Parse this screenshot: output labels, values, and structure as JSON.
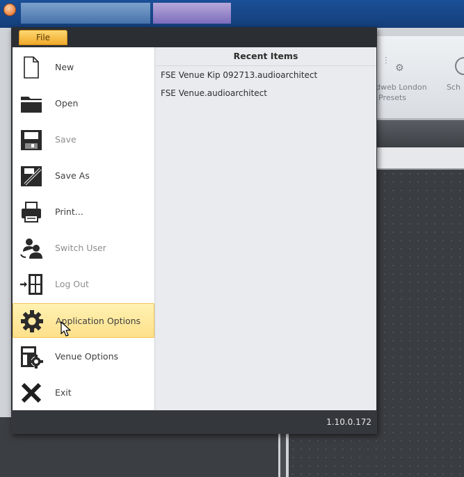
{
  "file_menu": {
    "tab_label": "File",
    "items": [
      {
        "label": "New",
        "icon": "new-document-icon",
        "enabled": true
      },
      {
        "label": "Open",
        "icon": "open-folder-icon",
        "enabled": true
      },
      {
        "label": "Save",
        "icon": "save-disk-icon",
        "enabled": false
      },
      {
        "label": "Save As",
        "icon": "save-as-icon",
        "enabled": true
      },
      {
        "label": "Print...",
        "icon": "printer-icon",
        "enabled": true
      },
      {
        "label": "Switch User",
        "icon": "switch-user-icon",
        "enabled": false
      },
      {
        "label": "Log Out",
        "icon": "log-out-icon",
        "enabled": false
      },
      {
        "label": "Application Options",
        "icon": "gear-icon",
        "enabled": true,
        "selected": true
      },
      {
        "label": "Venue Options",
        "icon": "venue-options-icon",
        "enabled": true
      },
      {
        "label": "Exit",
        "icon": "exit-x-icon",
        "enabled": true
      }
    ],
    "recent": {
      "header": "Recent Items",
      "items": [
        "FSE Venue Kip 092713.audioarchitect",
        "FSE Venue.audioarchitect"
      ]
    },
    "version": "1.10.0.172"
  },
  "ribbon": {
    "partial_labels": [
      "dweb London",
      "Presets",
      "Sch"
    ]
  },
  "colors": {
    "selection": "#fde08a",
    "file_tab": "#f0a92a",
    "menu_footer": "#34373c",
    "title_bar": "#1b4f97"
  }
}
